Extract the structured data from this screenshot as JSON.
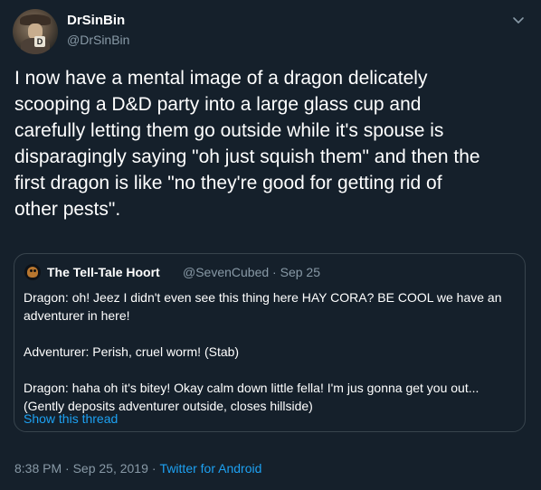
{
  "tweet": {
    "display_name": "DrSinBin",
    "handle": "@DrSinBin",
    "text": "I now have a mental image of a dragon delicately\nscooping a D&D party into a large glass cup and\ncarefully letting them go outside while it's spouse is\ndisparagingly saying \"oh just squish them\" and then the\nfirst dragon is like \"no they're good for getting rid of\nother pests\".",
    "timestamp": "8:38 PM · Sep 25, 2019",
    "source_separator": "·",
    "source": "Twitter for Android"
  },
  "quoted": {
    "display_name": "The Tell-Tale Hoort",
    "meta": "@SevenCubed · Sep 25",
    "text": "Dragon: oh! Jeez I didn't even see this thing here HAY CORA? BE COOL we have an\nadventurer in here!\n\nAdventurer: Perish, cruel worm! (Stab)\n\nDragon: haha oh it's bitey! Okay calm down little fella! I'm jus gonna get you out...\n(Gently deposits adventurer outside, closes hillside)",
    "link": "Show this thread"
  },
  "colors": {
    "background": "#15202b",
    "text": "#ffffff",
    "secondary": "#8899a6",
    "accent": "#1da1f2",
    "border": "#38444d"
  },
  "icons": {
    "menu": "chevron-down-icon"
  }
}
